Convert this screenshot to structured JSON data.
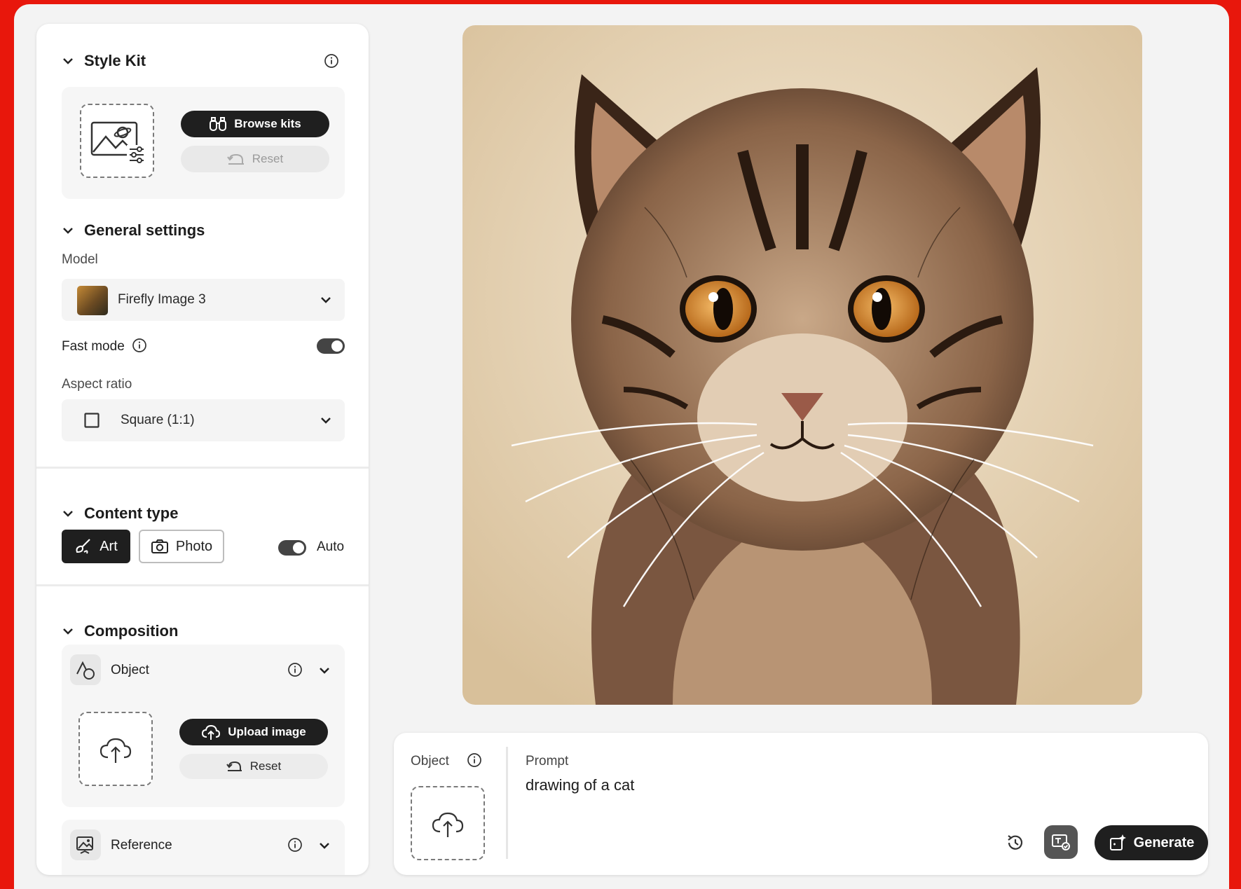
{
  "style_kit": {
    "title": "Style Kit",
    "browse_label": "Browse kits",
    "reset_label": "Reset"
  },
  "general": {
    "title": "General settings",
    "model_label": "Model",
    "model_value": "Firefly Image 3",
    "fast_mode_label": "Fast mode",
    "fast_mode_on": true,
    "aspect_label": "Aspect ratio",
    "aspect_value": "Square (1:1)"
  },
  "content_type": {
    "title": "Content type",
    "art_label": "Art",
    "photo_label": "Photo",
    "auto_label": "Auto",
    "auto_on": true,
    "selected": "Art"
  },
  "composition": {
    "title": "Composition",
    "object_label": "Object",
    "upload_label": "Upload image",
    "reset_label": "Reset",
    "reference_label": "Reference"
  },
  "prompt_bar": {
    "object_label": "Object",
    "prompt_label": "Prompt",
    "prompt_text": "drawing of a cat",
    "generate_label": "Generate"
  },
  "colors": {
    "frame": "#e8170c",
    "dark_button": "#1f1f1f",
    "panel": "#ffffff"
  }
}
